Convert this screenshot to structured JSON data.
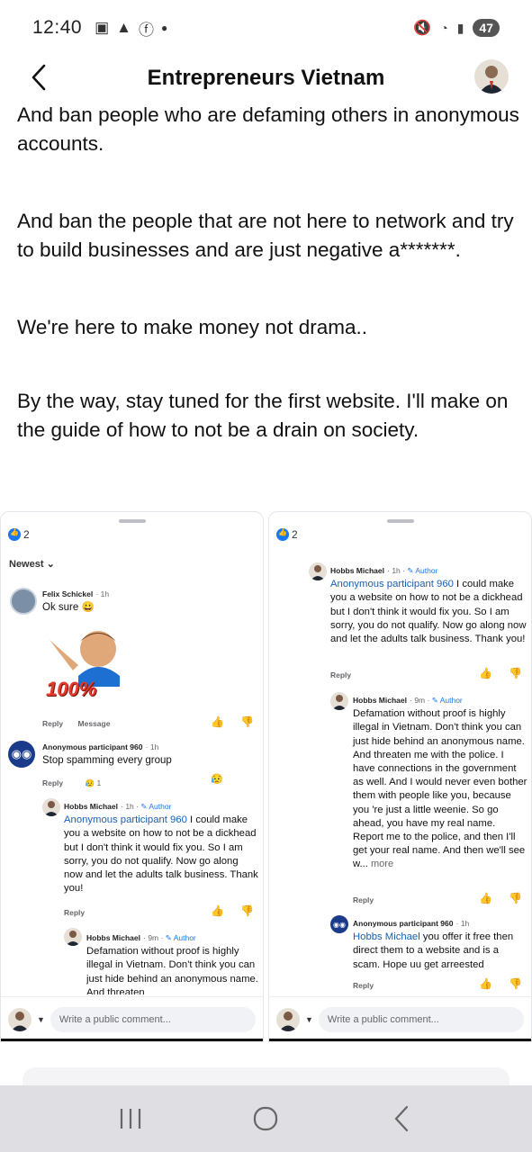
{
  "status": {
    "time": "12:40",
    "battery": "47"
  },
  "header": {
    "title": "Entrepreneurs Vietnam"
  },
  "post": {
    "paragraphs": [
      "And ban people who are defaming others in anonymous accounts.",
      "And ban the people that are not here to network and try to build businesses and are just negative a*******.",
      "We're here to make money not drama..",
      "By the way, stay tuned for the first website. I'll make on the guide of how to not be a drain on society."
    ]
  },
  "left_panel": {
    "reaction_count": "2",
    "sort": "Newest",
    "c1": {
      "name": "Felix Schickel",
      "time": "1h",
      "text": "Ok sure 😀",
      "sticker": "100%",
      "reply": "Reply",
      "message": "Message"
    },
    "c2": {
      "name": "Anonymous participant 960",
      "time": "1h",
      "text": "Stop spamming every group",
      "reply": "Reply",
      "react_count": "1"
    },
    "c3": {
      "name": "Hobbs Michael",
      "time": "1h",
      "author": "Author",
      "mention": "Anonymous participant 960",
      "text": " I could make you a website on how to not be a dickhead but I don't think it would fix you. So I am sorry, you do not qualify. Now go along now and let the adults talk business. Thank you!",
      "reply": "Reply"
    },
    "c4": {
      "name": "Hobbs Michael",
      "time": "9m",
      "author": "Author",
      "text": "Defamation without proof is highly illegal in Vietnam. Don't think you can just hide behind an anonymous name. And threaten"
    },
    "composer_placeholder": "Write a public comment..."
  },
  "right_panel": {
    "reaction_count": "2",
    "c1": {
      "name": "Hobbs Michael",
      "time": "1h",
      "author": "Author",
      "mention": "Anonymous participant 960",
      "text": " I could make you a website on how to not be a dickhead but I don't think it would fix you. So I am sorry, you do not qualify. Now go along now and let the adults talk business. Thank you!",
      "reply": "Reply"
    },
    "c2": {
      "name": "Hobbs Michael",
      "time": "9m",
      "author": "Author",
      "text": "Defamation without proof is highly illegal in Vietnam. Don't think you can just hide behind an anonymous name. And threaten me with the police. I have connections in the government as well. And I would never even bother them with people like you, because you 're just a little weenie. So go ahead, you have my real name. Report me to the police, and then I'll get your real name. And then we'll see w...",
      "more": " more",
      "reply": "Reply"
    },
    "c3": {
      "name": "Anonymous participant 960",
      "time": "1h",
      "mention": "Hobbs Michael",
      "text": " you offer it free then direct them to a website and is a scam.  Hope uu get arreested",
      "reply": "Reply"
    },
    "composer_placeholder": "Write a public comment..."
  }
}
